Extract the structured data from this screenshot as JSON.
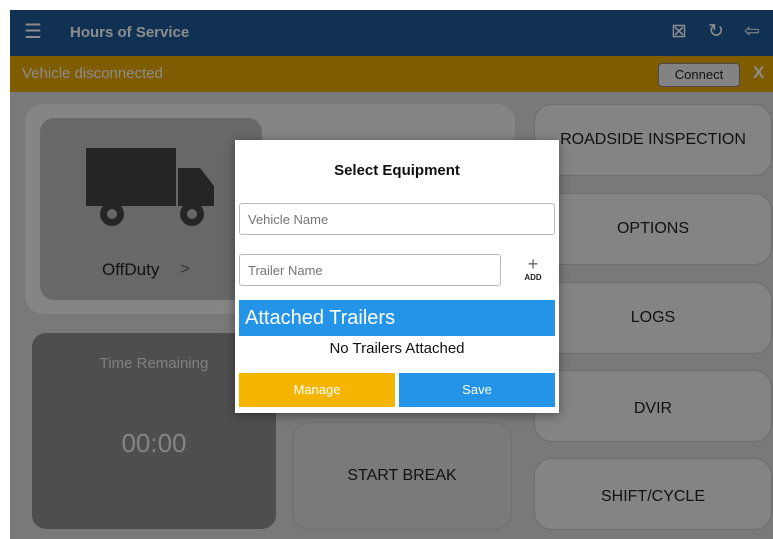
{
  "topbar": {
    "title": "Hours of Service",
    "menu_icon": "menu-icon",
    "icons": [
      "vehicle-connect-icon",
      "refresh-icon",
      "logout-icon"
    ]
  },
  "banner": {
    "message": "Vehicle disconnected",
    "connect_label": "Connect",
    "close_label": "X",
    "color": "#e8a800"
  },
  "status": {
    "label": "OffDuty",
    "chevron": ">"
  },
  "time_remaining": {
    "label": "Time Remaining",
    "value": "00:00"
  },
  "actions": {
    "start_break": "START BREAK"
  },
  "side_buttons": [
    "ROADSIDE INSPECTION",
    "OPTIONS",
    "LOGS",
    "DVIR",
    "SHIFT/CYCLE"
  ],
  "modal": {
    "title": "Select Equipment",
    "vehicle_placeholder": "Vehicle Name",
    "trailer_placeholder": "Trailer Name",
    "add_label": "ADD",
    "attached_header": "Attached Trailers",
    "no_trailers": "No Trailers Attached",
    "manage_label": "Manage",
    "save_label": "Save",
    "manage_color": "#f4b400",
    "save_color": "#2394e8"
  }
}
